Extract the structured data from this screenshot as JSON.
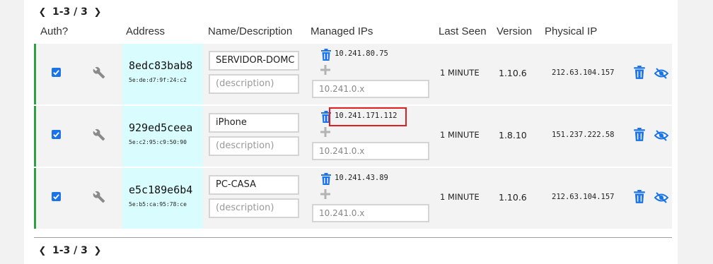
{
  "pager": {
    "label": "1-3 / 3"
  },
  "columns": {
    "auth": "Auth?",
    "address": "Address",
    "name": "Name/Description",
    "managed_ips": "Managed IPs",
    "last_seen": "Last Seen",
    "version": "Version",
    "physical_ip": "Physical IP"
  },
  "rows": [
    {
      "id": "8edc83bab8",
      "mac": "5e:de:d7:9f:24:c2",
      "name": "SERVIDOR-DOMC",
      "description_placeholder": "(description)",
      "ip": "10.241.80.75",
      "new_ip_placeholder": "10.241.0.x",
      "last_seen": "1 MINUTE",
      "version": "1.10.6",
      "physical_ip": "212.63.104.157",
      "authorized": true
    },
    {
      "id": "929ed5ceea",
      "mac": "5e:c2:95:c9:50:90",
      "name": "iPhone",
      "description_placeholder": "(description)",
      "ip": "10.241.171.112",
      "new_ip_placeholder": "10.241.0.x",
      "last_seen": "1 MINUTE",
      "version": "1.8.10",
      "physical_ip": "151.237.222.58",
      "authorized": true
    },
    {
      "id": "e5c189e6b4",
      "mac": "5e:b5:ca:95:78:ce",
      "name": "PC-CASA",
      "description_placeholder": "(description)",
      "ip": "10.241.43.89",
      "new_ip_placeholder": "10.241.0.x",
      "last_seen": "1 MINUTE",
      "version": "1.10.6",
      "physical_ip": "212.63.104.157",
      "authorized": true
    }
  ],
  "colors": {
    "accent": "#1a73e8",
    "auth_bar": "#2ea043",
    "address_bg": "#d9fdfe",
    "highlight": "#e01e1e"
  },
  "icons": {
    "prev": "chevron-left-icon",
    "next": "chevron-right-icon",
    "config": "wrench-icon",
    "remove_ip": "trash-icon",
    "add_ip": "plus-icon",
    "delete": "trash-icon",
    "hide": "eye-slash-icon"
  }
}
